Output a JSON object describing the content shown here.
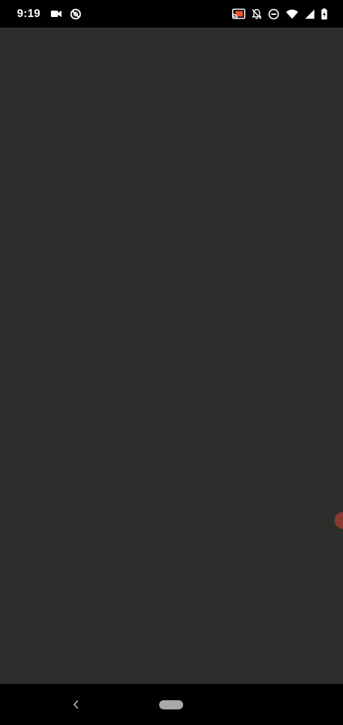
{
  "status_bar": {
    "time": "9:19",
    "left_icons": [
      "video-camera-icon",
      "do-not-disturb-alt-icon"
    ],
    "right_icons": [
      "cast-icon",
      "notifications-off-icon",
      "dnd-minus-icon",
      "wifi-icon",
      "signal-icon",
      "battery-icon"
    ],
    "cast_accent_color": "#e8542f"
  },
  "content": {
    "background_color": "#2d2e2c",
    "edge_handle_color": "#8b3a30"
  },
  "nav_bar": {
    "back": "back-icon",
    "home": "home-pill"
  }
}
